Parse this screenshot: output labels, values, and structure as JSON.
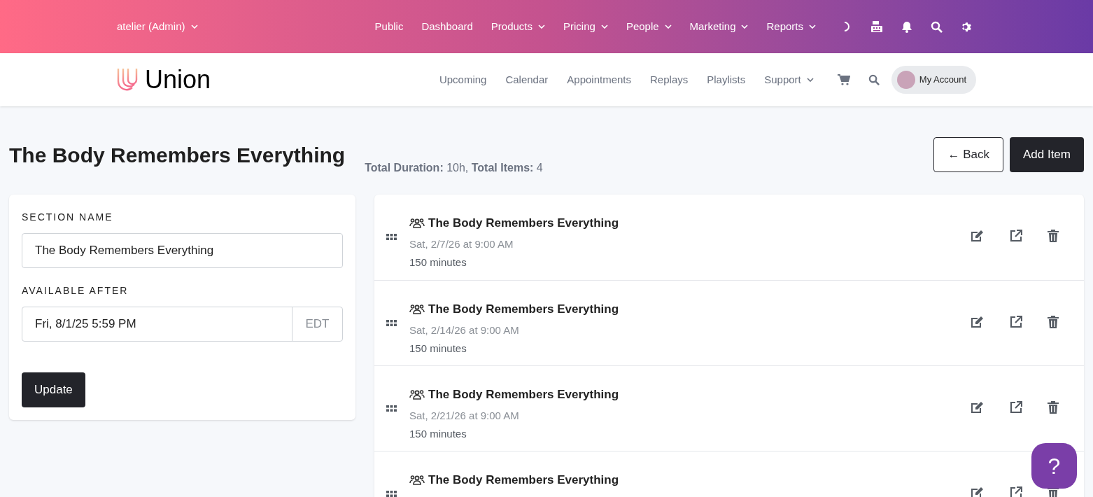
{
  "top_nav": {
    "account": "atelier (Admin)",
    "items": [
      {
        "label": "Public",
        "dropdown": false
      },
      {
        "label": "Dashboard",
        "dropdown": false
      },
      {
        "label": "Products",
        "dropdown": true
      },
      {
        "label": "Pricing",
        "dropdown": true
      },
      {
        "label": "People",
        "dropdown": true
      },
      {
        "label": "Marketing",
        "dropdown": true
      },
      {
        "label": "Reports",
        "dropdown": true
      }
    ]
  },
  "site_nav": {
    "brand": "Union",
    "items": [
      {
        "label": "Upcoming",
        "dropdown": false
      },
      {
        "label": "Calendar",
        "dropdown": false
      },
      {
        "label": "Appointments",
        "dropdown": false
      },
      {
        "label": "Replays",
        "dropdown": false
      },
      {
        "label": "Playlists",
        "dropdown": false
      },
      {
        "label": "Support",
        "dropdown": true
      }
    ],
    "account_button": "My Account"
  },
  "page": {
    "title": "The Body Remembers Everything",
    "summary": "**Total Duration:** 10h, **Total Items:** 4",
    "buttons": [
      {
        "label": "← Back",
        "kind": "outline"
      },
      {
        "label": "Add Item",
        "kind": "primary"
      }
    ]
  },
  "section_form": {
    "fields": [
      {
        "kind": "text",
        "label": "SECTION NAME",
        "value": "The Body Remembers Everything"
      },
      {
        "kind": "datetime",
        "label": "AVAILABLE AFTER",
        "value": "Fri, 8/1/25 5:59 PM",
        "suffix": "EDT"
      }
    ],
    "submit": "Update"
  },
  "items": [
    {
      "title": "The Body Remembers Everything",
      "date": "Sat, 2/7/26 at 9:00 AM",
      "duration": "150 minutes"
    },
    {
      "title": "The Body Remembers Everything",
      "date": "Sat, 2/14/26 at 9:00 AM",
      "duration": "150 minutes"
    },
    {
      "title": "The Body Remembers Everything",
      "date": "Sat, 2/21/26 at 9:00 AM",
      "duration": "150 minutes"
    },
    {
      "title": "The Body Remembers Everything"
    }
  ],
  "help_button": {
    "label": "?"
  }
}
